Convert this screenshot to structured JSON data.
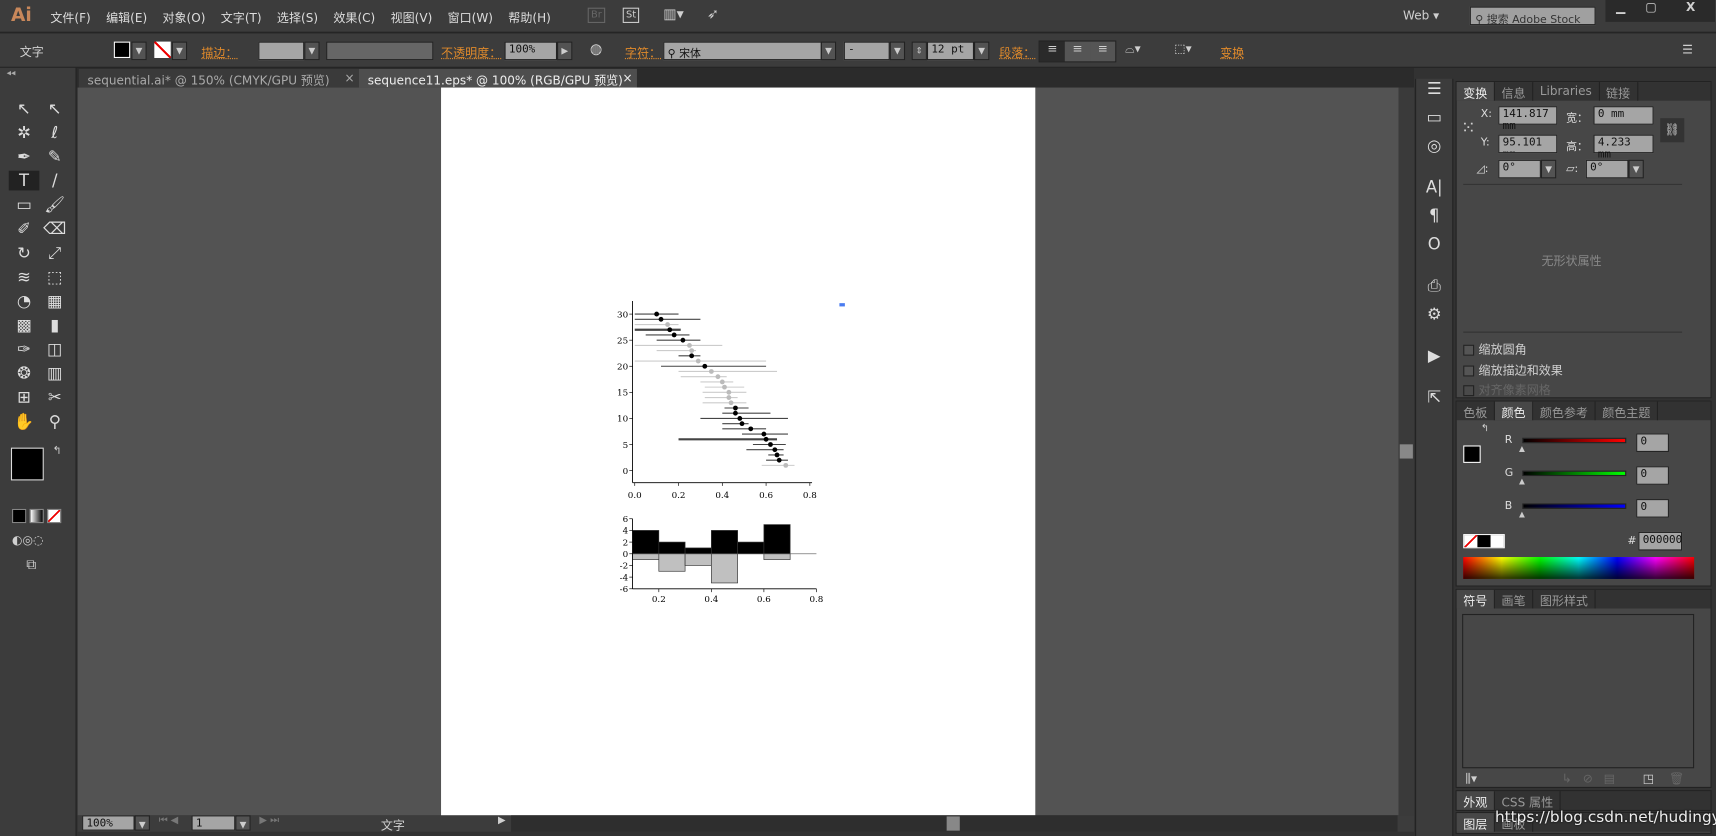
{
  "app": {
    "logo": "Ai",
    "menu": [
      "文件(F)",
      "编辑(E)",
      "对象(O)",
      "文字(T)",
      "选择(S)",
      "效果(C)",
      "视图(V)",
      "窗口(W)",
      "帮助(H)"
    ],
    "bridge": "Br",
    "stock": "St",
    "workspace": "Web",
    "search_placeholder": "搜索 Adobe Stock"
  },
  "control": {
    "tool_name": "文字",
    "stroke_label": "描边：",
    "opacity_label": "不透明度：",
    "opacity": "100%",
    "char_label": "字符：",
    "font": "宋体",
    "font_style": "-",
    "font_size": "12 pt",
    "para_label": "段落：",
    "transform_label": "变换"
  },
  "tabs": [
    {
      "label": "sequential.ai* @ 150% (CMYK/GPU 预览)"
    },
    {
      "label": "sequence11.eps* @ 100% (RGB/GPU 预览)"
    }
  ],
  "status": {
    "zoom": "100%",
    "artboard": "1",
    "tool": "文字"
  },
  "transform_panel": {
    "tabs": [
      "变换",
      "信息",
      "Libraries",
      "链接"
    ],
    "x_label": "X:",
    "x": "141.817 mm",
    "y_label": "Y:",
    "y": "95.101 mm",
    "w_label": "宽：",
    "w": "0 mm",
    "h_label": "高：",
    "h": "4.233 mm",
    "angle": "0°",
    "shear": "0°",
    "no_shape": "无形状属性",
    "options": [
      "缩放圆角",
      "缩放描边和效果",
      "对齐像素网格"
    ]
  },
  "color_panel": {
    "tabs": [
      "色板",
      "颜色",
      "颜色参考",
      "颜色主题"
    ],
    "r": "0",
    "g": "0",
    "b": "0",
    "r_label": "R",
    "g_label": "G",
    "b_label": "B",
    "hex_label": "#",
    "hex": "000000",
    "colors": {
      "r": "#ff0000",
      "g": "#00ff00",
      "b": "#0000ff"
    }
  },
  "symbol_panel": {
    "tabs": [
      "符号",
      "画笔",
      "图形样式"
    ]
  },
  "appearance_panel": {
    "tabs": [
      "外观",
      "CSS 属性"
    ]
  },
  "layers_panel": {
    "tabs": [
      "图层",
      "画板"
    ]
  },
  "watermark": "https://blog.csdn.net/hudingyin",
  "chart_data": [
    {
      "type": "scatter",
      "xlim": [
        0,
        0.8
      ],
      "ylim": [
        0,
        30
      ],
      "xticks": [
        "0.0",
        "0.2",
        "0.4",
        "0.6",
        "0.8"
      ],
      "yticks": [
        "0",
        "5",
        "10",
        "15",
        "20",
        "25",
        "30"
      ],
      "grid": false,
      "points": [
        {
          "y": 30,
          "x": 0.1,
          "lo": 0.0,
          "hi": 0.2,
          "c": "black"
        },
        {
          "y": 29,
          "x": 0.12,
          "lo": 0.0,
          "hi": 0.3,
          "c": "black"
        },
        {
          "y": 28,
          "x": 0.15,
          "lo": 0.0,
          "hi": 0.2,
          "c": "gray"
        },
        {
          "y": 27,
          "x": 0.16,
          "lo": 0.0,
          "hi": 0.21,
          "c": "black"
        },
        {
          "y": 26,
          "x": 0.18,
          "lo": 0.05,
          "hi": 0.25,
          "c": "black"
        },
        {
          "y": 25,
          "x": 0.22,
          "lo": 0.1,
          "hi": 0.3,
          "c": "black"
        },
        {
          "y": 24,
          "x": 0.25,
          "lo": 0.0,
          "hi": 0.4,
          "c": "gray"
        },
        {
          "y": 23,
          "x": 0.26,
          "lo": 0.1,
          "hi": 0.28,
          "c": "gray"
        },
        {
          "y": 22,
          "x": 0.26,
          "lo": 0.2,
          "hi": 0.3,
          "c": "black"
        },
        {
          "y": 21,
          "x": 0.29,
          "lo": 0.0,
          "hi": 0.6,
          "c": "gray"
        },
        {
          "y": 20,
          "x": 0.32,
          "lo": 0.12,
          "hi": 0.6,
          "c": "black"
        },
        {
          "y": 19,
          "x": 0.35,
          "lo": 0.2,
          "hi": 0.65,
          "c": "gray"
        },
        {
          "y": 18,
          "x": 0.38,
          "lo": 0.21,
          "hi": 0.42,
          "c": "gray"
        },
        {
          "y": 17,
          "x": 0.4,
          "lo": 0.3,
          "hi": 0.45,
          "c": "gray"
        },
        {
          "y": 16,
          "x": 0.41,
          "lo": 0.32,
          "hi": 0.5,
          "c": "gray"
        },
        {
          "y": 15,
          "x": 0.43,
          "lo": 0.31,
          "hi": 0.51,
          "c": "gray"
        },
        {
          "y": 14,
          "x": 0.43,
          "lo": 0.32,
          "hi": 0.47,
          "c": "gray"
        },
        {
          "y": 13,
          "x": 0.44,
          "lo": 0.31,
          "hi": 0.51,
          "c": "gray"
        },
        {
          "y": 12,
          "x": 0.46,
          "lo": 0.41,
          "hi": 0.52,
          "c": "black"
        },
        {
          "y": 11,
          "x": 0.46,
          "lo": 0.4,
          "hi": 0.62,
          "c": "black"
        },
        {
          "y": 10,
          "x": 0.48,
          "lo": 0.3,
          "hi": 0.7,
          "c": "black"
        },
        {
          "y": 9,
          "x": 0.49,
          "lo": 0.4,
          "hi": 0.52,
          "c": "black"
        },
        {
          "y": 8,
          "x": 0.53,
          "lo": 0.4,
          "hi": 0.6,
          "c": "black"
        },
        {
          "y": 7,
          "x": 0.59,
          "lo": 0.49,
          "hi": 0.7,
          "c": "black"
        },
        {
          "y": 6,
          "x": 0.6,
          "lo": 0.2,
          "hi": 0.65,
          "c": "black"
        },
        {
          "y": 5,
          "x": 0.62,
          "lo": 0.54,
          "hi": 0.69,
          "c": "black"
        },
        {
          "y": 4,
          "x": 0.64,
          "lo": 0.51,
          "hi": 0.68,
          "c": "black"
        },
        {
          "y": 3,
          "x": 0.65,
          "lo": 0.61,
          "hi": 0.68,
          "c": "black"
        },
        {
          "y": 2,
          "x": 0.66,
          "lo": 0.6,
          "hi": 0.7,
          "c": "black"
        },
        {
          "y": 1,
          "x": 0.69,
          "lo": 0.58,
          "hi": 0.73,
          "c": "gray"
        }
      ]
    },
    {
      "type": "bar",
      "xlim": [
        0.1,
        0.8
      ],
      "ylim": [
        -6,
        6
      ],
      "xticks": [
        "0.2",
        "0.4",
        "0.6",
        "0.8"
      ],
      "yticks": [
        "6",
        "4",
        "2",
        "0",
        "-2",
        "-4",
        "-6"
      ],
      "bins": [
        [
          0.1,
          0.2
        ],
        [
          0.2,
          0.3
        ],
        [
          0.3,
          0.4
        ],
        [
          0.4,
          0.5
        ],
        [
          0.5,
          0.6
        ],
        [
          0.6,
          0.7
        ]
      ],
      "series": [
        {
          "values": [
            4,
            2,
            1,
            4,
            2,
            5
          ],
          "color": "#000000"
        },
        {
          "values": [
            -1,
            -3,
            -2,
            -5,
            0,
            -1
          ],
          "color": "#c0c0c0"
        }
      ]
    }
  ]
}
